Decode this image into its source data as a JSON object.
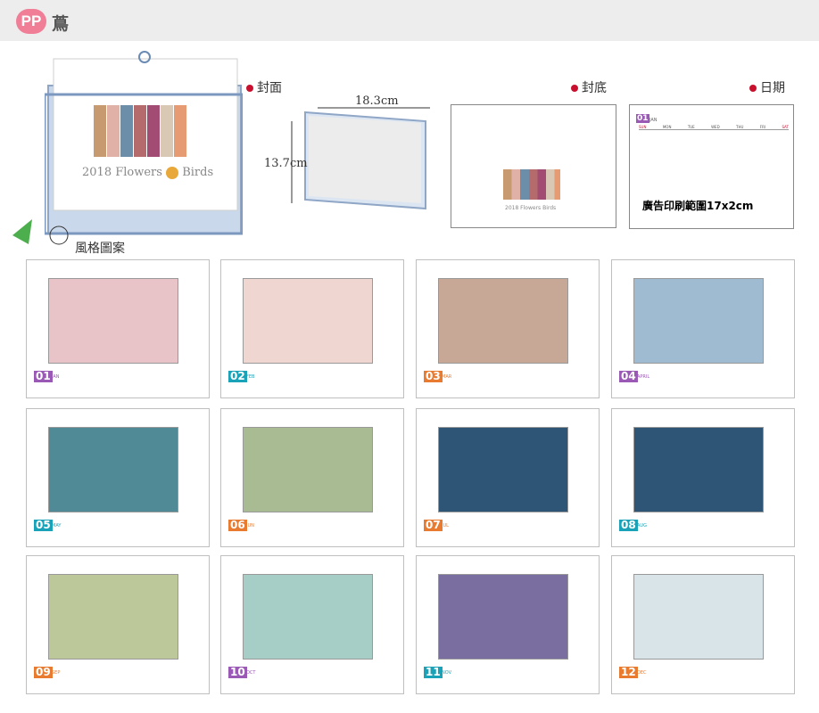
{
  "header": {
    "badge": "PP",
    "title": "蔦"
  },
  "labels": {
    "cover": "封面",
    "back": "封底",
    "date": "日期",
    "width": "18.3cm",
    "height": "13.7cm",
    "style": "風格圖案"
  },
  "cover": {
    "title_left": "2018 Flowers",
    "title_right": "Birds"
  },
  "back": {
    "title_left": "2018 Flowers",
    "title_right": "Birds"
  },
  "date_panel": {
    "month_num": "01",
    "month_name": "JAN",
    "weekdays": [
      "SUN",
      "MON",
      "TUE",
      "WED",
      "THU",
      "FRI",
      "SAT"
    ],
    "ad_text": "廣告印刷範圍17x2cm"
  },
  "colors": {
    "accent": "#c8102e",
    "pp": "#f07e96",
    "frame": "#8fa6c6"
  },
  "months": [
    {
      "num": "01",
      "name": "JAN",
      "color": "#9b59b6",
      "bg": "#e8c3c7"
    },
    {
      "num": "02",
      "name": "FEB",
      "color": "#1aa3b8",
      "bg": "#f0d6d0"
    },
    {
      "num": "03",
      "name": "MAR",
      "color": "#e87b2f",
      "bg": "#c7a897"
    },
    {
      "num": "04",
      "name": "APRIL",
      "color": "#9b59b6",
      "bg": "#9fbbd1"
    },
    {
      "num": "05",
      "name": "MAY",
      "color": "#1aa3b8",
      "bg": "#4f8a96"
    },
    {
      "num": "06",
      "name": "JUN",
      "color": "#e87b2f",
      "bg": "#a8bb93"
    },
    {
      "num": "07",
      "name": "JUL",
      "color": "#e87b2f",
      "bg": "#2e5476"
    },
    {
      "num": "08",
      "name": "AUG",
      "color": "#1aa3b8",
      "bg": "#2e5476"
    },
    {
      "num": "09",
      "name": "SEP",
      "color": "#e87b2f",
      "bg": "#bcc79a"
    },
    {
      "num": "10",
      "name": "OCT",
      "color": "#9b59b6",
      "bg": "#a7cdc7"
    },
    {
      "num": "11",
      "name": "NOV",
      "color": "#1aa3b8",
      "bg": "#7a6ea0"
    },
    {
      "num": "12",
      "name": "DEC",
      "color": "#e87b2f",
      "bg": "#d9e4e8"
    }
  ]
}
